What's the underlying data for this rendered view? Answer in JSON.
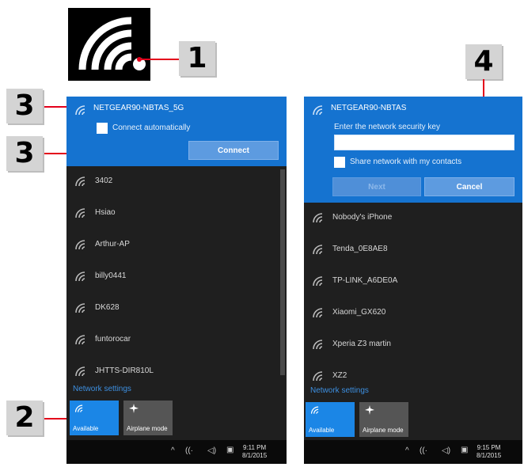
{
  "callouts": [
    "1",
    "2",
    "3",
    "3",
    "4"
  ],
  "left": {
    "selected_network": "NETGEAR90-NBTAS_5G",
    "connect_auto_label": "Connect automatically",
    "connect_button": "Connect",
    "networks": [
      "3402",
      "Hsiao",
      "Arthur-AP",
      "billy0441",
      "DK628",
      "funtorocar",
      "JHTTS-DIR810L"
    ],
    "network_settings": "Network settings",
    "tile_wifi": "Available",
    "tile_airplane": "Airplane mode",
    "clock_time": "9:11 PM",
    "clock_date": "8/1/2015"
  },
  "right": {
    "selected_network": "NETGEAR90-NBTAS",
    "security_prompt": "Enter the network security key",
    "security_value": "",
    "share_label": "Share network with my contacts",
    "next_button": "Next",
    "cancel_button": "Cancel",
    "networks": [
      "Nobody's iPhone",
      "Tenda_0E8AE8",
      "TP-LINK_A6DE0A",
      "Xiaomi_GX620",
      "Xperia Z3 martin",
      "XZ2"
    ],
    "network_settings": "Network settings",
    "tile_wifi": "Available",
    "tile_airplane": "Airplane mode",
    "clock_time": "9:15 PM",
    "clock_date": "8/1/2015"
  },
  "colors": {
    "accent": "#1573d0",
    "panel": "#1f1f1f",
    "callout_line": "#e3001b",
    "callout_box": "#d4d4d4"
  },
  "icons": [
    "wifi-logo-icon",
    "wifi-icon",
    "airplane-icon",
    "chevron-up-icon",
    "volume-icon",
    "notification-icon"
  ]
}
